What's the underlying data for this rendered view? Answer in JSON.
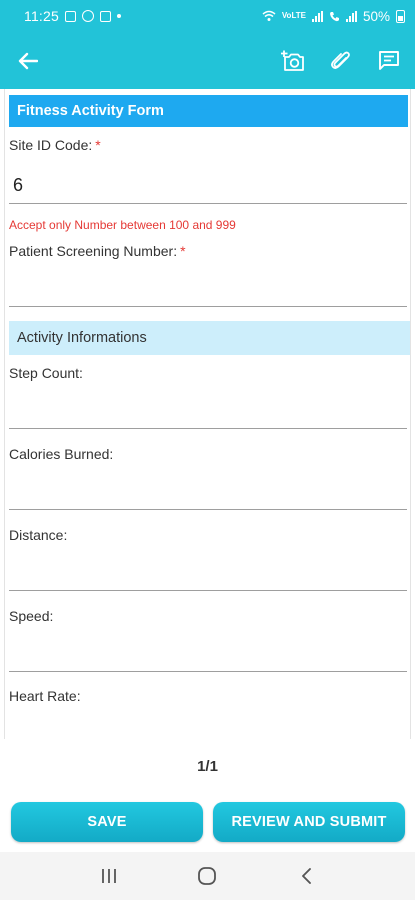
{
  "status_bar": {
    "time": "11:25",
    "battery": "50%",
    "network_label": "Vo) LTE1"
  },
  "app_bar": {
    "back_icon": "arrow-left-icon",
    "actions": [
      "camera-add-icon",
      "paperclip-icon",
      "message-icon"
    ]
  },
  "form": {
    "title": "Fitness Activity Form",
    "site_id": {
      "label": "Site ID Code:",
      "required_mark": "*",
      "value": "6",
      "hint": "Accept only Number between 100 and 999"
    },
    "screening": {
      "label": "Patient Screening Number:",
      "required_mark": "*",
      "value": ""
    },
    "section_title": "Activity Informations",
    "fields": {
      "step_count": {
        "label": "Step Count:",
        "value": ""
      },
      "calories": {
        "label": "Calories Burned:",
        "value": ""
      },
      "distance": {
        "label": "Distance:",
        "value": ""
      },
      "speed": {
        "label": "Speed:",
        "value": ""
      },
      "heart_rate": {
        "label": "Heart Rate:",
        "value": ""
      }
    }
  },
  "pagination": {
    "text": "1/1"
  },
  "buttons": {
    "save": "SAVE",
    "review_submit": "REVIEW AND SUBMIT"
  },
  "colors": {
    "primary": "#22c3d8",
    "form_header": "#1ea9f0",
    "section_header": "#cdeefb",
    "error": "#e53935"
  }
}
